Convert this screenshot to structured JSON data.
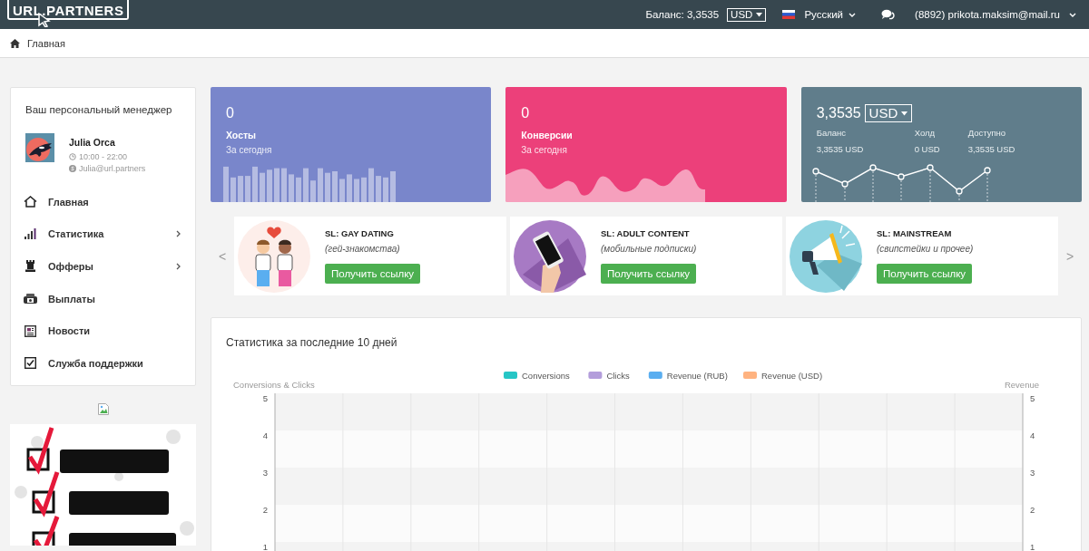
{
  "header": {
    "logo": "URL.PARTNERS",
    "balance": "Баланс: 3,3535",
    "currency": "USD",
    "language": "Русский",
    "account": "(8892) prikota.maksim@mail.ru"
  },
  "breadcrumb": {
    "label": "Главная"
  },
  "manager": {
    "title": "Ваш персональный менеджер",
    "name": "Julia Orca",
    "hours": "10:00 - 22:00",
    "skype": "Julia@url.partners"
  },
  "nav": [
    {
      "label": "Главная",
      "has_submenu": false
    },
    {
      "label": "Статистика",
      "has_submenu": true
    },
    {
      "label": "Офферы",
      "has_submenu": true
    },
    {
      "label": "Выплаты",
      "has_submenu": false
    },
    {
      "label": "Новости",
      "has_submenu": false
    },
    {
      "label": "Служба поддержки",
      "has_submenu": false
    }
  ],
  "stats": [
    {
      "kind": "bars",
      "value": "0",
      "label": "Хосты",
      "sub": "За сегодня",
      "color": "#7986cb"
    },
    {
      "kind": "wave",
      "value": "0",
      "label": "Конверсии",
      "sub": "За сегодня",
      "color": "#ec407a"
    },
    {
      "kind": "balance",
      "value": "3,3535",
      "currency": "USD",
      "color": "#607d8b",
      "columns": [
        {
          "label": "Баланс",
          "value": "3,3535 USD"
        },
        {
          "label": "Холд",
          "value": "0 USD"
        },
        {
          "label": "Доступно",
          "value": "3,3535 USD"
        }
      ]
    }
  ],
  "offers": {
    "prev": "<",
    "next": ">",
    "items": [
      {
        "title": "SL: GAY DATING",
        "subtitle": "(гей-знакомства)",
        "button": "Получить ссылку"
      },
      {
        "title": "SL: ADULT CONTENT",
        "subtitle": "(мобильные подписки)",
        "button": "Получить ссылку"
      },
      {
        "title": "SL: MAINSTREAM",
        "subtitle": "(свипстейки и прочее)",
        "button": "Получить ссылку"
      }
    ]
  },
  "chart": {
    "title": "Статистика за последние 10 дней",
    "legend": [
      {
        "name": "Conversions",
        "color": "#26c6c6"
      },
      {
        "name": "Clicks",
        "color": "#b39ddb"
      },
      {
        "name": "Revenue (RUB)",
        "color": "#5aaef0"
      },
      {
        "name": "Revenue (USD)",
        "color": "#ffb380"
      }
    ],
    "left_axis": {
      "title": "Conversions & Clicks",
      "ticks": [
        "5",
        "4",
        "3",
        "2",
        "1"
      ]
    },
    "right_axis": {
      "title": "Revenue",
      "ticks": [
        "5",
        "4",
        "3",
        "2",
        "1"
      ]
    }
  }
}
